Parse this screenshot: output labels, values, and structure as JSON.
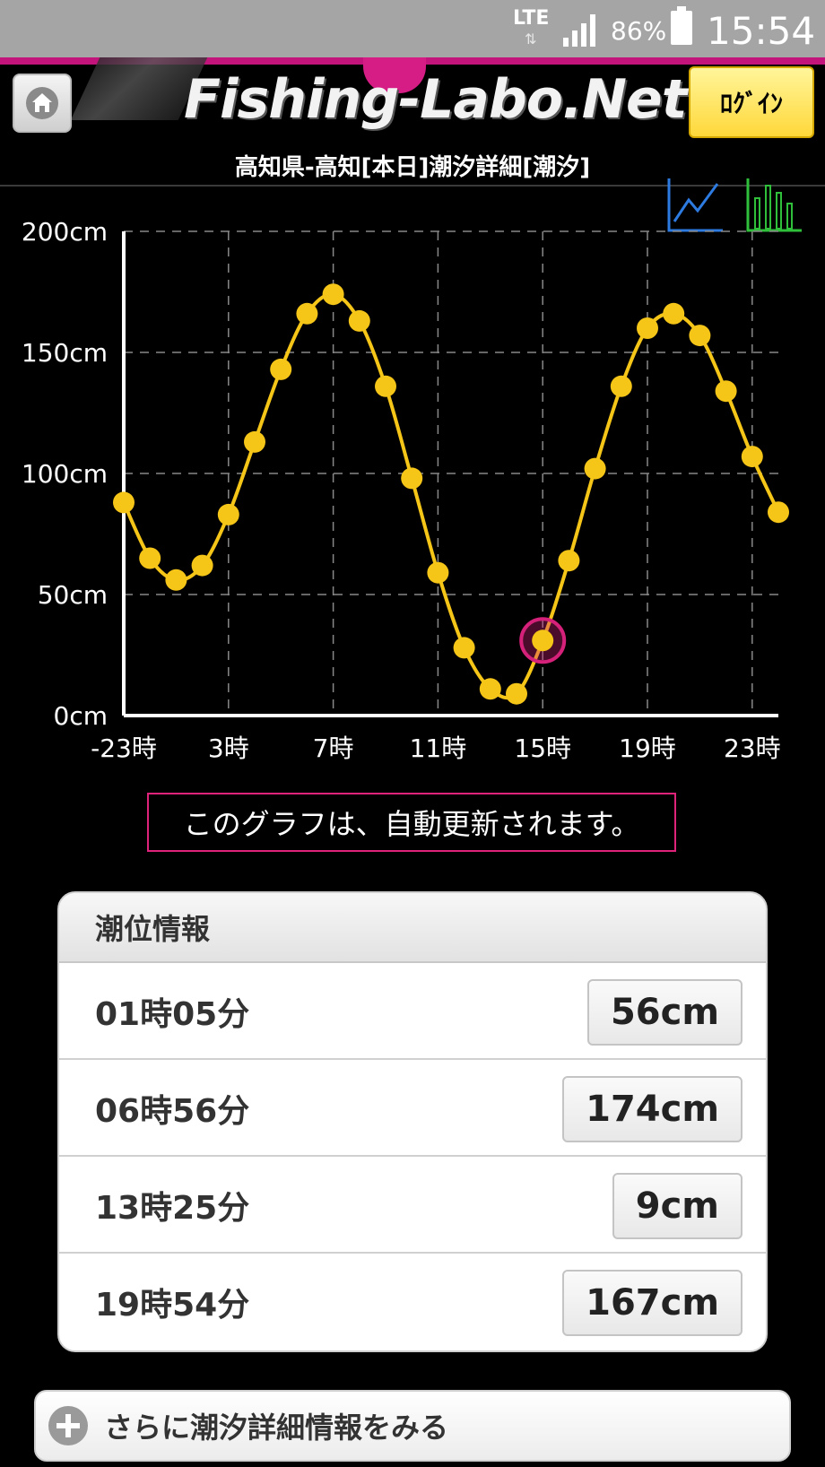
{
  "status_bar": {
    "network": "LTE",
    "battery": "86%",
    "time": "15:54"
  },
  "header": {
    "logo": "Fishing-Labo.Net",
    "login_label": "ﾛｸﾞｲﾝ",
    "page_title": "高知県-高知[本日]潮汐詳細[潮汐]"
  },
  "chart_data": {
    "type": "line",
    "x_tick_labels": [
      "-23時",
      "3時",
      "7時",
      "11時",
      "15時",
      "19時",
      "23時"
    ],
    "y_tick_labels": [
      "0cm",
      "50cm",
      "100cm",
      "150cm",
      "200cm"
    ],
    "ylim": [
      0,
      200
    ],
    "x": [
      -1,
      0,
      1,
      2,
      3,
      4,
      5,
      6,
      7,
      8,
      9,
      10,
      11,
      12,
      13,
      14,
      15,
      16,
      17,
      18,
      19,
      20,
      21,
      22,
      23,
      24
    ],
    "values": [
      88,
      65,
      56,
      62,
      83,
      113,
      143,
      166,
      174,
      163,
      136,
      98,
      59,
      28,
      11,
      9,
      31,
      64,
      102,
      136,
      160,
      166,
      157,
      134,
      107,
      84
    ],
    "highlight_x": 15,
    "grid": true,
    "line_color": "#f5c518",
    "highlight_color": "#d6217a"
  },
  "notice": "このグラフは、自動更新されます。",
  "tide_info": {
    "title": "潮位情報",
    "rows": [
      {
        "time": "01時05分",
        "value": "56cm"
      },
      {
        "time": "06時56分",
        "value": "174cm"
      },
      {
        "time": "13時25分",
        "value": "9cm"
      },
      {
        "time": "19時54分",
        "value": "167cm"
      }
    ]
  },
  "more_button": "さらに潮汐詳細情報をみる"
}
